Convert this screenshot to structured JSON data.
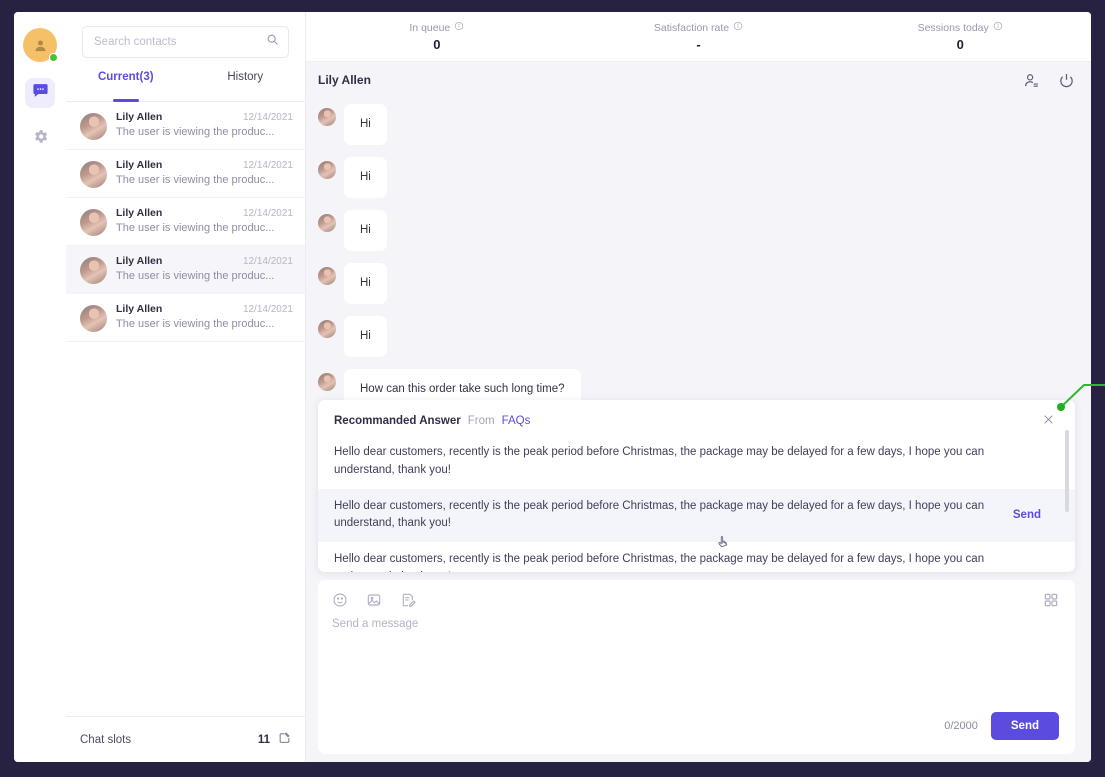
{
  "rail": {
    "avatar_name": "agent-avatar",
    "status": "online",
    "items": [
      {
        "icon": "chat-bubble-icon",
        "active": true
      },
      {
        "icon": "gear-icon",
        "active": false
      }
    ]
  },
  "sidebar": {
    "search": {
      "placeholder": "Search contacts",
      "value": "",
      "icon": "search-icon"
    },
    "tabs": [
      {
        "label": "Current(3)",
        "active": true
      },
      {
        "label": "History",
        "active": false
      }
    ],
    "contacts": [
      {
        "name": "Lily Allen",
        "date": "12/14/2021",
        "preview": "The user is viewing the produc...",
        "selected": false
      },
      {
        "name": "Lily Allen",
        "date": "12/14/2021",
        "preview": "The user is viewing the produc...",
        "selected": false
      },
      {
        "name": "Lily Allen",
        "date": "12/14/2021",
        "preview": "The user is viewing the produc...",
        "selected": false
      },
      {
        "name": "Lily Allen",
        "date": "12/14/2021",
        "preview": "The user is viewing the produc...",
        "selected": true
      },
      {
        "name": "Lily Allen",
        "date": "12/14/2021",
        "preview": "The user is viewing the produc...",
        "selected": false
      }
    ],
    "footer": {
      "label": "Chat slots",
      "count": "11",
      "icon": "edit-square-icon"
    }
  },
  "stats": [
    {
      "label": "In queue",
      "value": "0",
      "info_icon": "info-icon"
    },
    {
      "label": "Satisfaction rate",
      "value": "-",
      "info_icon": "info-icon"
    },
    {
      "label": "Sessions today",
      "value": "0",
      "info_icon": "info-icon"
    }
  ],
  "chat": {
    "title": "Lily Allen",
    "head_icons": [
      {
        "name": "transfer-chat-icon"
      },
      {
        "name": "end-chat-power-icon"
      }
    ],
    "messages": [
      {
        "text": "Hi",
        "from": "customer"
      },
      {
        "text": "Hi",
        "from": "customer"
      },
      {
        "text": "Hi",
        "from": "customer"
      },
      {
        "text": "Hi",
        "from": "customer"
      },
      {
        "text": "Hi",
        "from": "customer"
      },
      {
        "text": "How can this order take such long time?",
        "from": "customer"
      }
    ]
  },
  "recommended": {
    "title": "Recommanded Answer",
    "from_label": "From",
    "source": "FAQs",
    "close_icon": "close-icon",
    "items": [
      {
        "text": "Hello dear customers, recently is the peak period before Christmas, the package may be delayed for a few days, I hope you can understand, thank you!",
        "hovered": false,
        "send_label": ""
      },
      {
        "text": "Hello dear customers, recently is the peak period before Christmas, the package may be delayed for a few days, I hope you can understand, thank you!",
        "hovered": true,
        "send_label": "Send"
      },
      {
        "text": "Hello dear customers, recently is the peak period before Christmas, the package may be delayed for a few days, I hope you can understand, thank you!",
        "hovered": false,
        "send_label": ""
      }
    ]
  },
  "composer": {
    "tools": [
      {
        "name": "emoji-icon"
      },
      {
        "name": "image-icon"
      },
      {
        "name": "canned-response-icon"
      }
    ],
    "apps_icon": "grid-apps-icon",
    "placeholder": "Send a message",
    "value": "",
    "counter": "0/2000",
    "send_label": "Send"
  },
  "colors": {
    "accent": "#5b4ce0",
    "frame": "#272142",
    "canvas": "#f4f4f9",
    "online": "#48c13a",
    "annotation": "#1fae1f"
  }
}
